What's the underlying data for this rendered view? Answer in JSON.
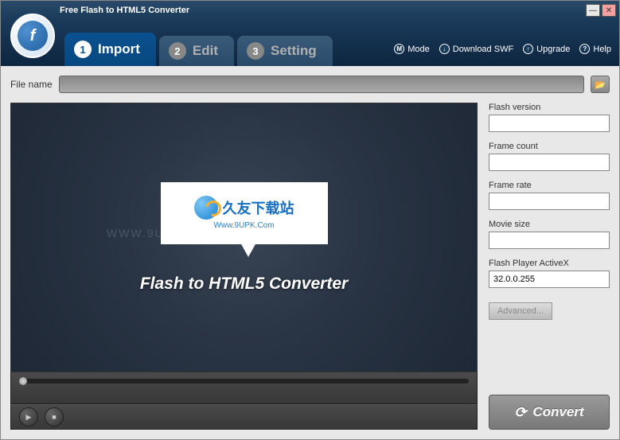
{
  "window": {
    "title": "Free Flash to HTML5 Converter"
  },
  "logo": {
    "glyph": "f"
  },
  "tabs": [
    {
      "num": "1",
      "label": "Import",
      "active": true
    },
    {
      "num": "2",
      "label": "Edit",
      "active": false
    },
    {
      "num": "3",
      "label": "Setting",
      "active": false
    }
  ],
  "tools": [
    {
      "icon": "M",
      "label": "Mode"
    },
    {
      "icon": "↓",
      "label": "Download SWF"
    },
    {
      "icon": "↑",
      "label": "Upgrade"
    },
    {
      "icon": "?",
      "label": "Help"
    }
  ],
  "filename": {
    "label": "File name",
    "value": ""
  },
  "preview": {
    "watermark_bg": "WWW.9UPK.COM",
    "cn_text": "久友下载站",
    "url": "Www.9UPK.Com",
    "title": "Flash to HTML5 Converter"
  },
  "fields": {
    "flash_version": {
      "label": "Flash version",
      "value": ""
    },
    "frame_count": {
      "label": "Frame count",
      "value": ""
    },
    "frame_rate": {
      "label": "Frame rate",
      "value": ""
    },
    "movie_size": {
      "label": "Movie size",
      "value": ""
    },
    "activex": {
      "label": "Flash Player ActiveX",
      "value": "32.0.0.255"
    }
  },
  "buttons": {
    "advanced": "Advanced...",
    "convert": "Convert",
    "browse_icon": "📂"
  }
}
